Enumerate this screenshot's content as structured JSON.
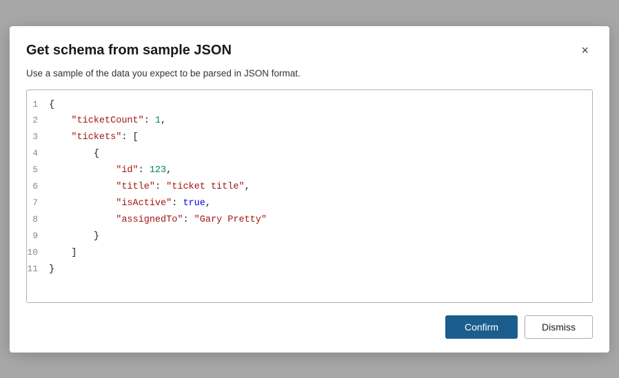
{
  "dialog": {
    "title": "Get schema from sample JSON",
    "subtitle": "Use a sample of the data you expect to be parsed in JSON format.",
    "close_label": "×"
  },
  "code": {
    "lines": [
      {
        "num": 1,
        "parts": [
          {
            "type": "brace",
            "text": "{"
          }
        ]
      },
      {
        "num": 2,
        "parts": [
          {
            "type": "indent",
            "text": "    "
          },
          {
            "type": "key",
            "text": "\"ticketCount\""
          },
          {
            "type": "colon",
            "text": ": "
          },
          {
            "type": "num",
            "text": "1"
          },
          {
            "type": "comma",
            "text": ","
          }
        ]
      },
      {
        "num": 3,
        "parts": [
          {
            "type": "indent",
            "text": "    "
          },
          {
            "type": "key",
            "text": "\"tickets\""
          },
          {
            "type": "colon",
            "text": ": "
          },
          {
            "type": "bracket",
            "text": "["
          }
        ]
      },
      {
        "num": 4,
        "parts": [
          {
            "type": "indent",
            "text": "        "
          },
          {
            "type": "brace",
            "text": "{"
          }
        ]
      },
      {
        "num": 5,
        "parts": [
          {
            "type": "indent",
            "text": "            "
          },
          {
            "type": "key",
            "text": "\"id\""
          },
          {
            "type": "colon",
            "text": ": "
          },
          {
            "type": "num",
            "text": "123"
          },
          {
            "type": "comma",
            "text": ","
          }
        ]
      },
      {
        "num": 6,
        "parts": [
          {
            "type": "indent",
            "text": "            "
          },
          {
            "type": "key",
            "text": "\"title\""
          },
          {
            "type": "colon",
            "text": ": "
          },
          {
            "type": "str",
            "text": "\"ticket title\""
          },
          {
            "type": "comma",
            "text": ","
          }
        ]
      },
      {
        "num": 7,
        "parts": [
          {
            "type": "indent",
            "text": "            "
          },
          {
            "type": "key",
            "text": "\"isActive\""
          },
          {
            "type": "colon",
            "text": ": "
          },
          {
            "type": "bool",
            "text": "true"
          },
          {
            "type": "comma",
            "text": ","
          }
        ]
      },
      {
        "num": 8,
        "parts": [
          {
            "type": "indent",
            "text": "            "
          },
          {
            "type": "key",
            "text": "\"assignedTo\""
          },
          {
            "type": "colon",
            "text": ": "
          },
          {
            "type": "str",
            "text": "\"Gary Pretty\""
          }
        ]
      },
      {
        "num": 9,
        "parts": [
          {
            "type": "indent",
            "text": "        "
          },
          {
            "type": "brace",
            "text": "}"
          }
        ]
      },
      {
        "num": 10,
        "parts": [
          {
            "type": "indent",
            "text": "    "
          },
          {
            "type": "bracket",
            "text": "]"
          }
        ]
      },
      {
        "num": 11,
        "parts": [
          {
            "type": "brace",
            "text": "}"
          }
        ]
      }
    ]
  },
  "footer": {
    "confirm_label": "Confirm",
    "dismiss_label": "Dismiss"
  },
  "colors": {
    "confirm_bg": "#1b5e8e",
    "key_color": "#a31515",
    "num_color": "#098658",
    "str_color": "#a31515",
    "bool_color": "#0000ff"
  }
}
